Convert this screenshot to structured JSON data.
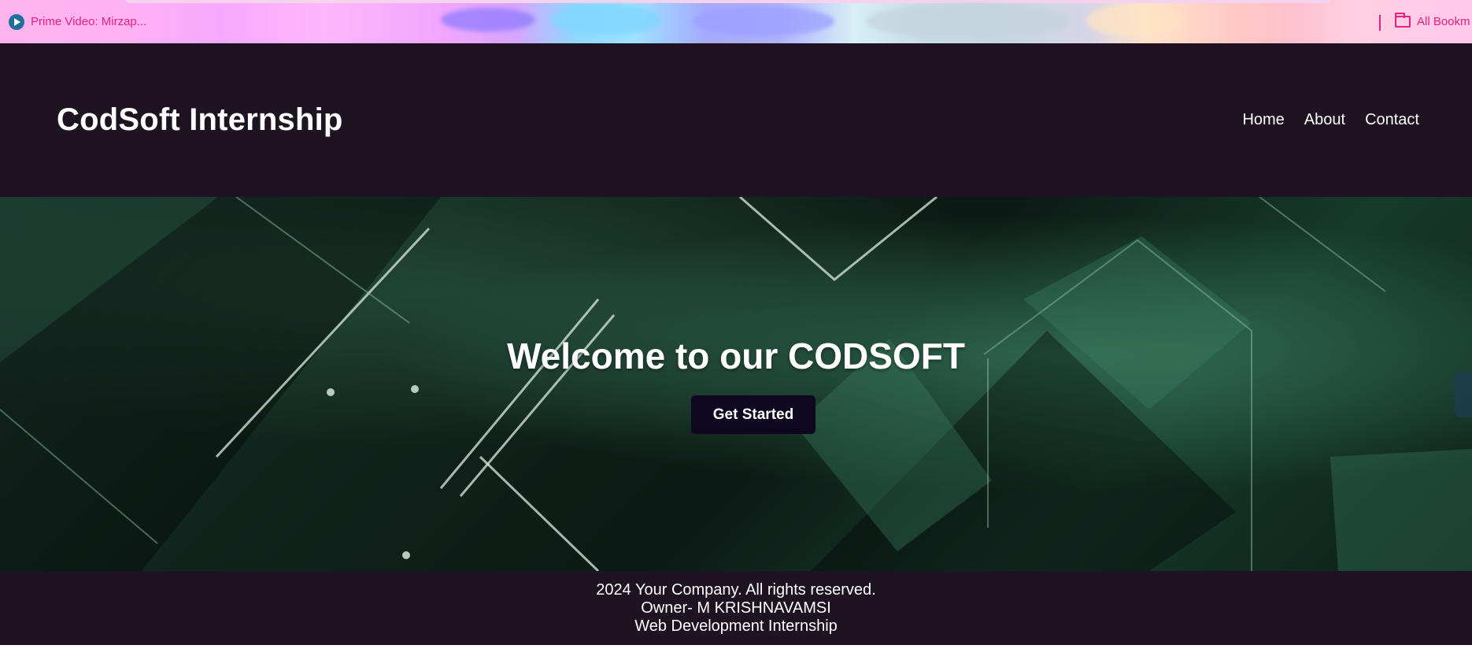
{
  "bookmarks_bar": {
    "items": [
      {
        "label": "Prime Video: Mirzap...",
        "icon": "play-icon"
      },
      {
        "label": "All Bookm",
        "icon": "folder-icon"
      }
    ]
  },
  "header": {
    "title": "CodSoft Internship",
    "nav": [
      "Home",
      "About",
      "Contact"
    ]
  },
  "hero": {
    "title": "Welcome to our CODSOFT",
    "cta_label": "Get Started"
  },
  "footer": {
    "lines": [
      "2024 Your Company. All rights reserved.",
      "Owner- M KRISHNAVAMSI",
      "Web Development Internship"
    ]
  },
  "colors": {
    "header_bg": "#1e1321",
    "cta_bg": "#0f0720",
    "bookmark_text": "#e8207e",
    "hero_green": "#173a2c"
  }
}
